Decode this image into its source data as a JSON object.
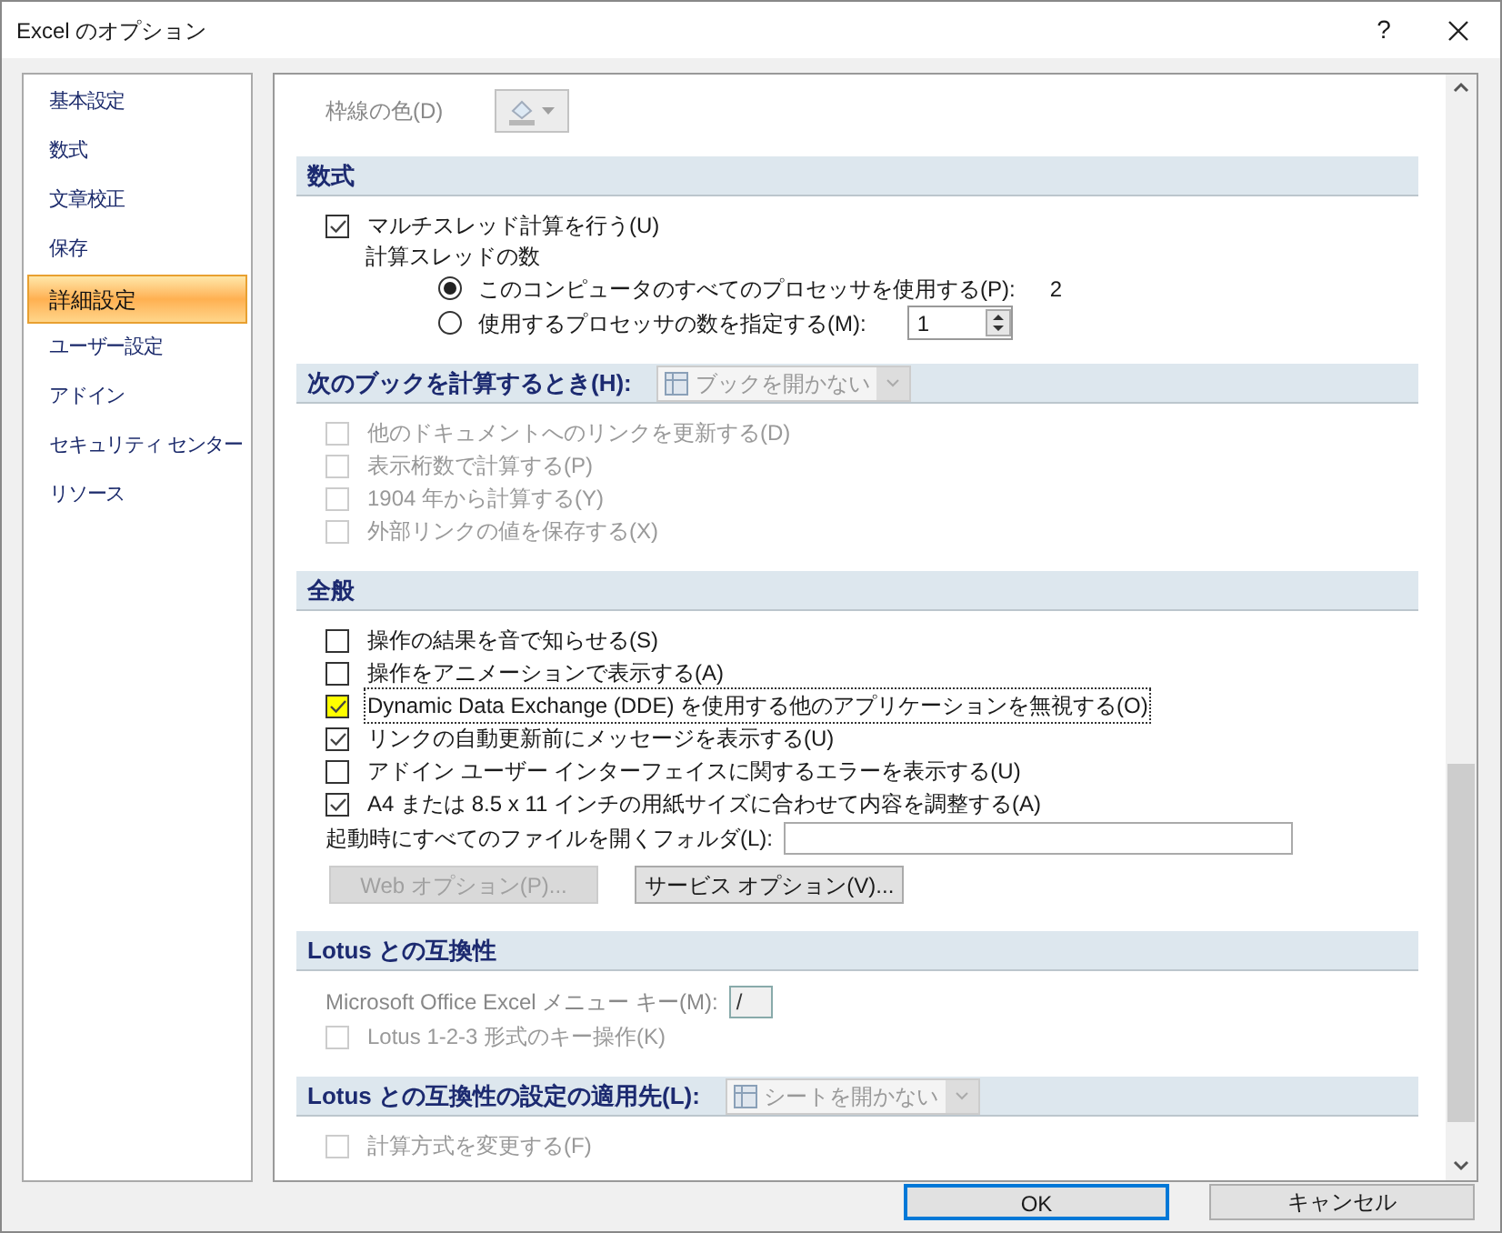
{
  "window": {
    "title": "Excel のオプション",
    "help": "?"
  },
  "sidebar": {
    "items": [
      {
        "label": "基本設定",
        "selected": false
      },
      {
        "label": "数式",
        "selected": false
      },
      {
        "label": "文章校正",
        "selected": false
      },
      {
        "label": "保存",
        "selected": false
      },
      {
        "label": "詳細設定",
        "selected": true
      },
      {
        "label": "ユーザー設定",
        "selected": false
      },
      {
        "label": "アドイン",
        "selected": false
      },
      {
        "label": "セキュリティ センター",
        "selected": false
      },
      {
        "label": "リソース",
        "selected": false
      }
    ]
  },
  "sections": [
    {
      "items": [
        {
          "kind": "color",
          "label": "枠線の色(D)",
          "disabled": true
        }
      ]
    },
    {
      "title": "数式",
      "items": [
        {
          "kind": "checkbox",
          "label": "マルチスレッド計算を行う(U)",
          "checked": true,
          "disabled": false
        },
        {
          "kind": "label",
          "label": "計算スレッドの数"
        },
        {
          "kind": "radio",
          "label": "このコンピュータのすべてのプロセッサを使用する(P):",
          "selected": true,
          "value": "2"
        },
        {
          "kind": "radio_spin",
          "label": "使用するプロセッサの数を指定する(M):",
          "selected": false,
          "value": "1"
        }
      ]
    },
    {
      "title": "次のブックを計算するとき(H):",
      "dropdown": {
        "value": "ブックを開かない",
        "disabled": true
      },
      "items": [
        {
          "kind": "checkbox",
          "label": "他のドキュメントへのリンクを更新する(D)",
          "checked": false,
          "disabled": true
        },
        {
          "kind": "checkbox",
          "label": "表示桁数で計算する(P)",
          "checked": false,
          "disabled": true
        },
        {
          "kind": "checkbox",
          "label": "1904 年から計算する(Y)",
          "checked": false,
          "disabled": true
        },
        {
          "kind": "checkbox",
          "label": "外部リンクの値を保存する(X)",
          "checked": false,
          "disabled": true
        }
      ]
    },
    {
      "title": "全般",
      "items": [
        {
          "kind": "checkbox",
          "label": "操作の結果を音で知らせる(S)",
          "checked": false,
          "disabled": false
        },
        {
          "kind": "checkbox",
          "label": "操作をアニメーションで表示する(A)",
          "checked": false,
          "disabled": false
        },
        {
          "kind": "checkbox",
          "label": "Dynamic Data Exchange (DDE) を使用する他のアプリケーションを無視する(O)",
          "checked": true,
          "disabled": false,
          "highlighted": true,
          "focused": true
        },
        {
          "kind": "checkbox",
          "label": "リンクの自動更新前にメッセージを表示する(U)",
          "checked": true,
          "disabled": false
        },
        {
          "kind": "checkbox",
          "label": "アドイン ユーザー インターフェイスに関するエラーを表示する(U)",
          "checked": false,
          "disabled": false
        },
        {
          "kind": "checkbox",
          "label": "A4 または 8.5 x 11 インチの用紙サイズに合わせて内容を調整する(A)",
          "checked": true,
          "disabled": false
        },
        {
          "kind": "textfield",
          "label": "起動時にすべてのファイルを開くフォルダ(L):"
        },
        {
          "kind": "buttons",
          "buttons": [
            {
              "label": "Web オプション(P)...",
              "disabled": true
            },
            {
              "label": "サービス オプション(V)...",
              "disabled": false
            }
          ]
        }
      ]
    },
    {
      "title": "Lotus との互換性",
      "items": [
        {
          "kind": "keyfield",
          "label": "Microsoft Office Excel メニュー キー(M):",
          "value": "/",
          "disabled": true
        },
        {
          "kind": "checkbox",
          "label": "Lotus 1-2-3 形式のキー操作(K)",
          "checked": false,
          "disabled": true
        }
      ]
    },
    {
      "title": "Lotus との互換性の設定の適用先(L):",
      "dropdown": {
        "value": "シートを開かない",
        "disabled": true
      },
      "items": [
        {
          "kind": "checkbox",
          "label": "計算方式を変更する(F)",
          "checked": false,
          "disabled": true
        }
      ]
    }
  ],
  "buttons": [
    {
      "label": "OK",
      "default": true
    },
    {
      "label": "キャンセル",
      "default": false
    }
  ]
}
